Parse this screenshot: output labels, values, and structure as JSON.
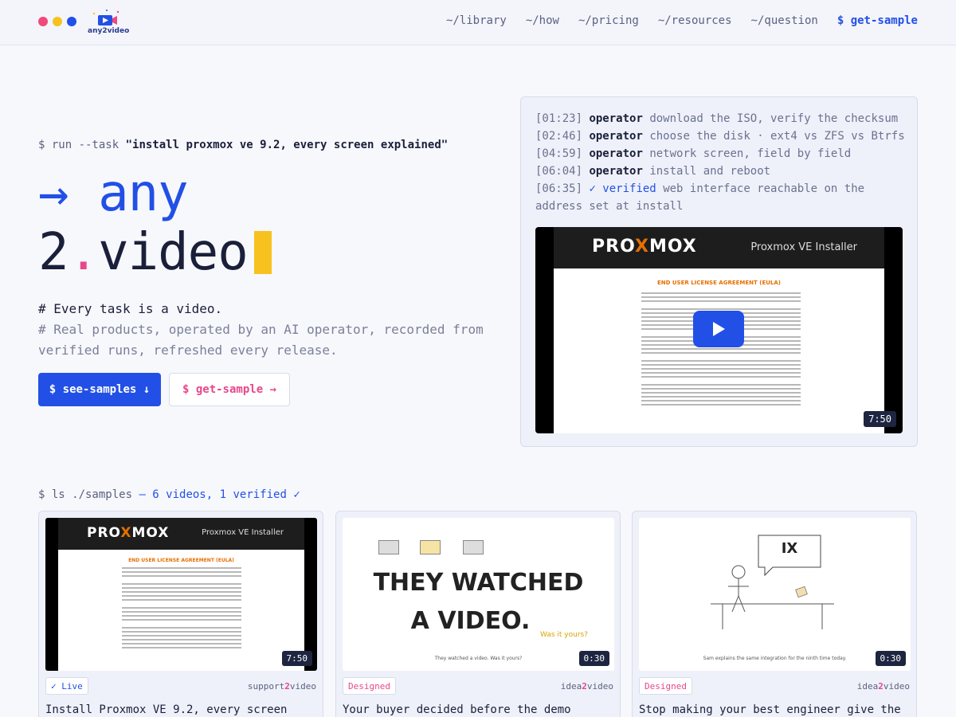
{
  "header": {
    "logo_text": "any2video",
    "dots": [
      "#ef4a7b",
      "#f7c21e",
      "#2250e6"
    ],
    "nav": [
      {
        "label": "~/library"
      },
      {
        "label": "~/how"
      },
      {
        "label": "~/pricing"
      },
      {
        "label": "~/resources"
      },
      {
        "label": "~/question"
      }
    ],
    "cta": "$ get-sample"
  },
  "hero": {
    "run_prefix": "$ run --task",
    "run_task": "\"install proxmox ve 9.2, every screen explained\"",
    "title_arrow": "→",
    "title_any": "any",
    "title_two": "2",
    "title_dot": ".",
    "title_video": "video",
    "desc_line1": "# Every task is a video.",
    "desc_line2": "# Real products, operated by an AI operator, recorded from verified runs, refreshed every release.",
    "btn_primary": "$ see-samples ↓",
    "btn_secondary": "$ get-sample →"
  },
  "panel": {
    "log": [
      {
        "ts": "[01:23]",
        "actor": "operator",
        "text": "download the ISO, verify the checksum"
      },
      {
        "ts": "[02:46]",
        "actor": "operator",
        "text": "choose the disk · ext4 vs ZFS vs Btrfs"
      },
      {
        "ts": "[04:59]",
        "actor": "operator",
        "text": "network screen, field by field"
      },
      {
        "ts": "[06:04]",
        "actor": "operator",
        "text": "install and reboot"
      },
      {
        "ts": "[06:35]",
        "actor": "✓ verified",
        "text": "web interface reachable on the address set at install"
      }
    ],
    "video": {
      "brand_pre": "PRO",
      "brand_x": "X",
      "brand_post": "MOX",
      "installer": "Proxmox VE Installer",
      "eula_title": "END USER LICENSE AGREEMENT (EULA)",
      "duration": "7:50"
    }
  },
  "samples": {
    "ls_prefix": "$ ls ./samples",
    "ls_summary": "— 6 videos, 1 verified ✓",
    "cards": [
      {
        "badge": "✓ Live",
        "brand_pre": "support",
        "brand_two": "2",
        "brand_post": "video",
        "duration": "7:50",
        "title": "Install Proxmox VE 9.2, every screen",
        "thumb": {
          "brand_pre": "PRO",
          "brand_x": "X",
          "brand_post": "MOX",
          "installer": "Proxmox VE Installer",
          "eula_title": "END USER LICENSE AGREEMENT (EULA)"
        }
      },
      {
        "badge": "Designed",
        "brand_pre": "idea",
        "brand_two": "2",
        "brand_post": "video",
        "duration": "0:30",
        "title": "Your buyer decided before the demo",
        "thumb": {
          "line1": "THEY WATCHED",
          "line2": "A VIDEO.",
          "note": "Was it yours?",
          "caption": "They watched a video. Was it yours?"
        }
      },
      {
        "badge": "Designed",
        "brand_pre": "idea",
        "brand_two": "2",
        "brand_post": "video",
        "duration": "0:30",
        "title": "Stop making your best engineer give the",
        "thumb": {
          "bubble": "IX",
          "caption": "Sam explains the same integration for the ninth time today."
        }
      }
    ]
  }
}
